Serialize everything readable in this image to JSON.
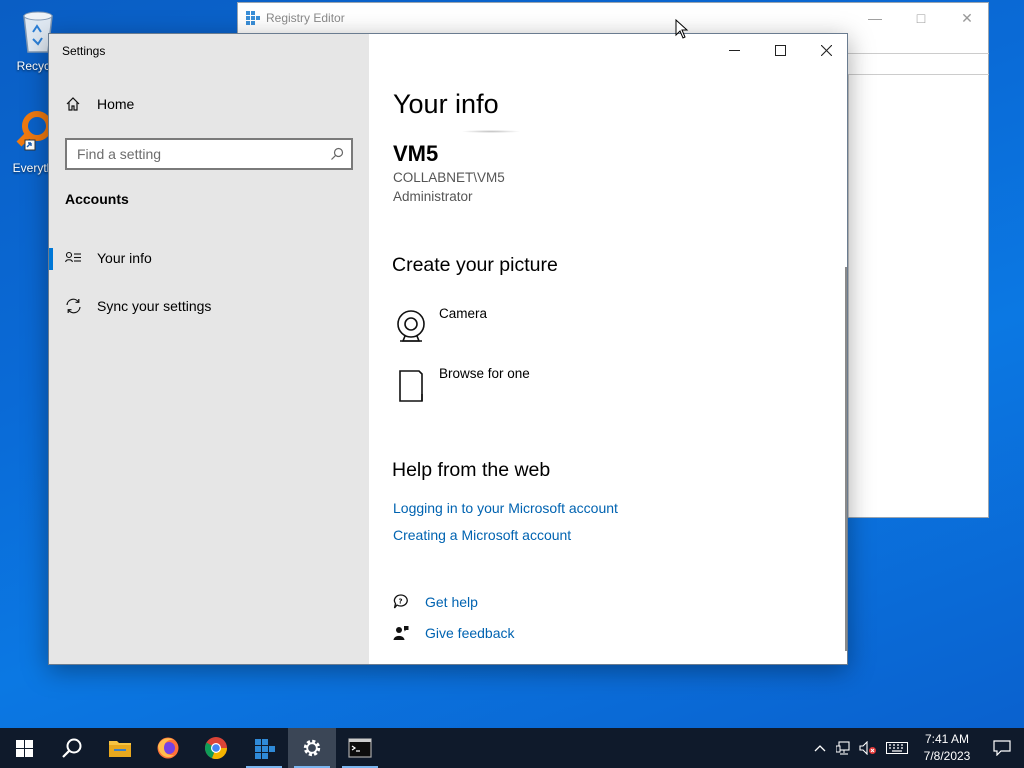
{
  "desktop": {
    "icons": [
      {
        "label": "Recycle"
      },
      {
        "label": "Everyth"
      }
    ]
  },
  "regedit": {
    "title": "Registry Editor"
  },
  "settings": {
    "title": "Settings",
    "sidebar": {
      "home_label": "Home",
      "search_placeholder": "Find a setting",
      "section_title": "Accounts",
      "items": [
        {
          "label": "Your info",
          "active": true
        },
        {
          "label": "Sync your settings",
          "active": false
        }
      ]
    },
    "main": {
      "heading": "Your info",
      "user_name": "VM5",
      "user_domain": "COLLABNET\\VM5",
      "user_role": "Administrator",
      "picture_heading": "Create your picture",
      "picture_options": [
        {
          "label": "Camera",
          "icon": "camera-icon"
        },
        {
          "label": "Browse for one",
          "icon": "document-icon"
        }
      ],
      "help_heading": "Help from the web",
      "help_links": [
        "Logging in to your Microsoft account",
        "Creating a Microsoft account"
      ],
      "get_help": "Get help",
      "give_feedback": "Give feedback"
    }
  },
  "taskbar": {
    "clock_time": "7:41 AM",
    "clock_date": "7/8/2023"
  },
  "colors": {
    "accent": "#0078d7",
    "link": "#0063b1",
    "sidebar_bg": "#e6e6e6",
    "taskbar_bg": "#0f1a2b"
  }
}
